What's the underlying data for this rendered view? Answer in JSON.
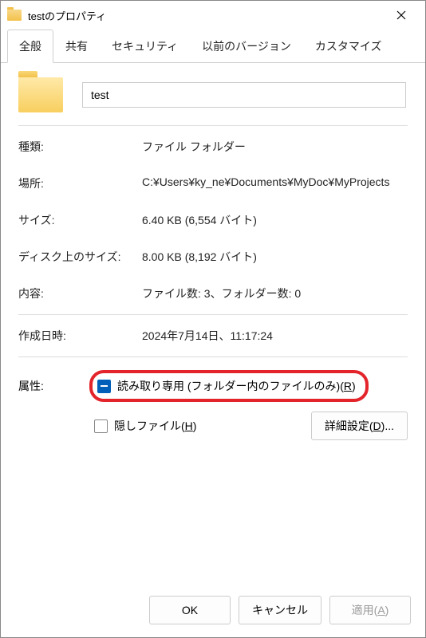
{
  "titlebar": {
    "title": "testのプロパティ"
  },
  "tabs": {
    "general": "全般",
    "sharing": "共有",
    "security": "セキュリティ",
    "versions": "以前のバージョン",
    "customize": "カスタマイズ"
  },
  "folder": {
    "name": "test"
  },
  "labels": {
    "type": "種類:",
    "location": "場所:",
    "size": "サイズ:",
    "size_on_disk": "ディスク上のサイズ:",
    "contents": "内容:",
    "created": "作成日時:",
    "attributes": "属性:"
  },
  "values": {
    "type": "ファイル フォルダー",
    "location": "C:¥Users¥ky_ne¥Documents¥MyDoc¥MyProjects",
    "size": "6.40 KB (6,554 バイト)",
    "size_on_disk": "8.00 KB (8,192 バイト)",
    "contents": "ファイル数: 3、フォルダー数: 0",
    "created": "2024年7月14日、11:17:24"
  },
  "attributes": {
    "readonly_prefix": "読み取り専用 (フォルダー内のファイルのみ)(",
    "readonly_key": "R",
    "readonly_suffix": ")",
    "hidden_prefix": "隠しファイル(",
    "hidden_key": "H",
    "hidden_suffix": ")",
    "advanced_prefix": "詳細設定(",
    "advanced_key": "D",
    "advanced_suffix": ")..."
  },
  "buttons": {
    "ok": "OK",
    "cancel": "キャンセル",
    "apply_prefix": "適用(",
    "apply_key": "A",
    "apply_suffix": ")"
  }
}
